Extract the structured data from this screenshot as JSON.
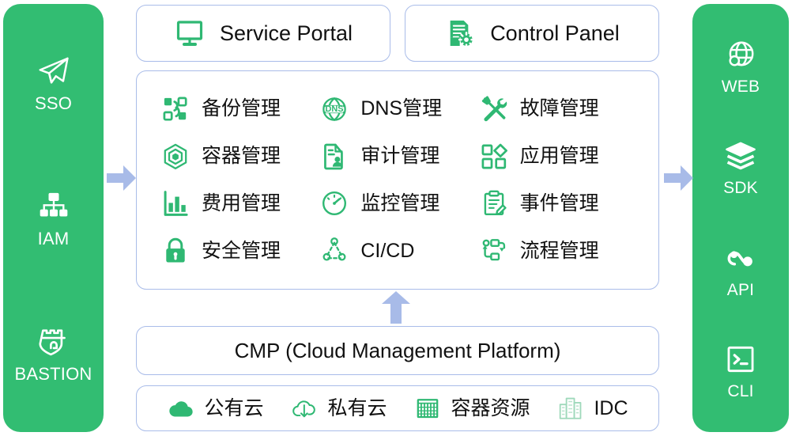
{
  "colors": {
    "green": "#32bd72",
    "icon_green": "#2fb873",
    "border_blue": "#a9bce9",
    "arrow_blue": "#a8bbe8",
    "text_dark": "#111111",
    "white": "#ffffff"
  },
  "left_rail": {
    "items": [
      {
        "label": "SSO",
        "icon": "paper-plane-icon"
      },
      {
        "label": "IAM",
        "icon": "org-chart-icon"
      },
      {
        "label": "BASTION",
        "icon": "shield-castle-icon"
      }
    ]
  },
  "right_rail": {
    "items": [
      {
        "label": "WEB",
        "icon": "globe-icon"
      },
      {
        "label": "SDK",
        "icon": "layers-icon"
      },
      {
        "label": "API",
        "icon": "api-link-icon"
      },
      {
        "label": "CLI",
        "icon": "terminal-icon"
      }
    ]
  },
  "top_cards": [
    {
      "title": "Service Portal",
      "icon": "monitor-icon"
    },
    {
      "title": "Control Panel",
      "icon": "document-gear-icon"
    }
  ],
  "features": [
    {
      "label": "备份管理",
      "icon": "backup-transfer-icon"
    },
    {
      "label": "DNS管理",
      "icon": "dns-globe-icon"
    },
    {
      "label": "故障管理",
      "icon": "wrench-screwdriver-icon"
    },
    {
      "label": "容器管理",
      "icon": "container-hexagon-icon"
    },
    {
      "label": "审计管理",
      "icon": "audit-document-icon"
    },
    {
      "label": "应用管理",
      "icon": "app-squares-icon"
    },
    {
      "label": "费用管理",
      "icon": "bar-chart-icon"
    },
    {
      "label": "监控管理",
      "icon": "gauge-icon"
    },
    {
      "label": "事件管理",
      "icon": "clipboard-edit-icon"
    },
    {
      "label": "安全管理",
      "icon": "lock-icon"
    },
    {
      "label": "CI/CD",
      "icon": "cicd-nodes-icon"
    },
    {
      "label": "流程管理",
      "icon": "workflow-icon"
    }
  ],
  "cmp": {
    "title": "CMP (Cloud Management Platform)"
  },
  "resources": [
    {
      "label": "公有云",
      "icon": "cloud-filled-icon"
    },
    {
      "label": "私有云",
      "icon": "cloud-download-icon"
    },
    {
      "label": "容器资源",
      "icon": "container-grid-icon"
    },
    {
      "label": "IDC",
      "icon": "buildings-icon"
    }
  ],
  "arrows": {
    "left": "arrow-right-into-grid",
    "right": "arrow-right-into-rail",
    "up": "arrow-up-into-grid"
  }
}
